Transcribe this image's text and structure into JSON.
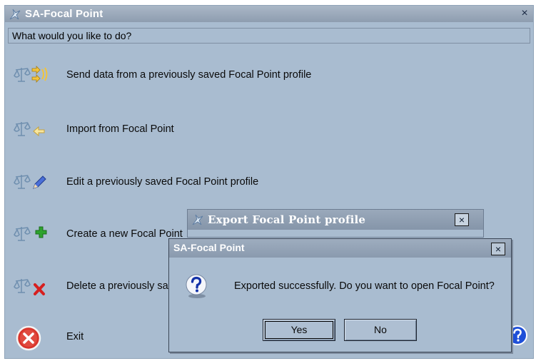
{
  "main_window": {
    "title": "SA-Focal Point",
    "close_glyph": "×",
    "prompt": "What would you like to do?",
    "menu": [
      {
        "label": "Send data from a previously saved Focal Point profile",
        "icon": "scale-send-icon"
      },
      {
        "label": "Import from Focal Point",
        "icon": "scale-import-icon"
      },
      {
        "label": "Edit a previously saved Focal Point profile",
        "icon": "scale-edit-icon"
      },
      {
        "label": "Create a new Focal Point",
        "icon": "scale-create-icon"
      },
      {
        "label": "Delete a previously sa",
        "icon": "scale-delete-icon"
      },
      {
        "label": "Exit",
        "icon": "exit-icon"
      }
    ]
  },
  "export_dialog": {
    "title": "Export Focal Point profile",
    "close_glyph": "×"
  },
  "message_box": {
    "title": "SA-Focal Point",
    "close_glyph": "×",
    "message": "Exported successfully. Do you want to open Focal Point?",
    "yes_label": "Yes",
    "no_label": "No"
  },
  "colors": {
    "window_bg": "#a9bcd0",
    "titlebar": "#8e9db0",
    "title_text": "#ffffff"
  }
}
